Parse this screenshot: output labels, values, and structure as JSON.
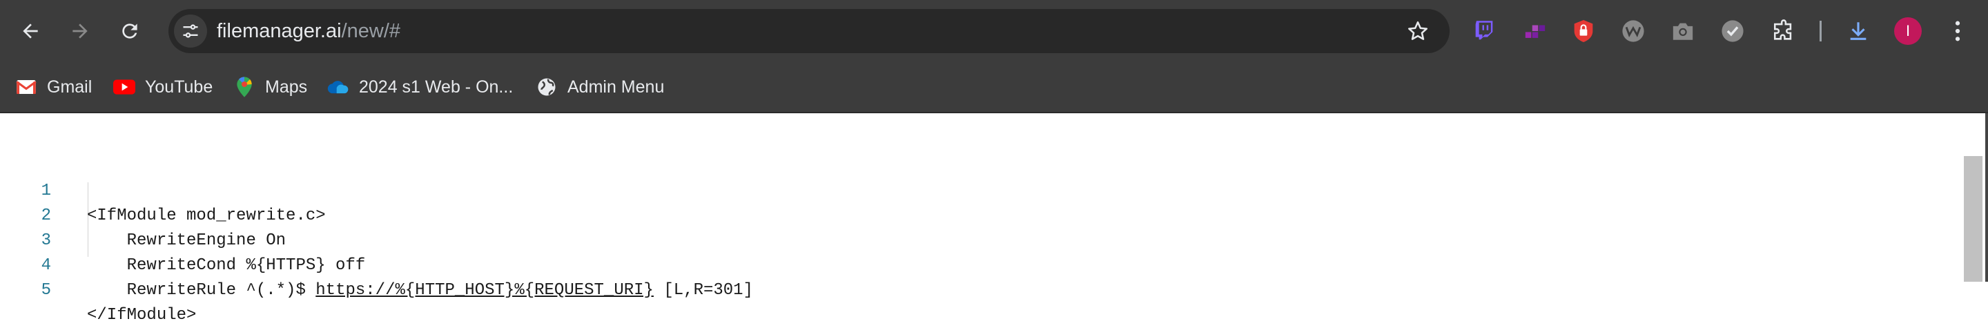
{
  "browser": {
    "url_host": "filemanager.ai",
    "url_path": "/new/#",
    "avatar_letter": "I"
  },
  "toolbar": {
    "back_icon": "back-arrow-icon",
    "forward_icon": "forward-arrow-icon",
    "reload_icon": "reload-icon",
    "extensions": [
      "twitch-icon",
      "puzzle-blocks-icon",
      "shield-icon",
      "w-icon",
      "camera-icon",
      "check-icon",
      "extensions-puzzle-icon"
    ]
  },
  "bookmarks": [
    {
      "label": "Gmail",
      "icon": "gmail-icon"
    },
    {
      "label": "YouTube",
      "icon": "youtube-icon"
    },
    {
      "label": "Maps",
      "icon": "maps-icon"
    },
    {
      "label": "2024 s1 Web - On...",
      "icon": "onedrive-icon"
    },
    {
      "label": "Admin Menu",
      "icon": "globe-icon"
    }
  ],
  "editor": {
    "lines": [
      {
        "num": "1",
        "text": "<IfModule mod_rewrite.c>"
      },
      {
        "num": "2",
        "text": "    RewriteEngine On"
      },
      {
        "num": "3",
        "text": "    RewriteCond %{HTTPS} off"
      },
      {
        "num": "4",
        "prefix": "    RewriteRule ^(.*)$ ",
        "link": "https://%{HTTP_HOST}%{REQUEST_URI}",
        "suffix": " [L,R=301]"
      },
      {
        "num": "5",
        "text": "</IfModule>"
      }
    ]
  }
}
